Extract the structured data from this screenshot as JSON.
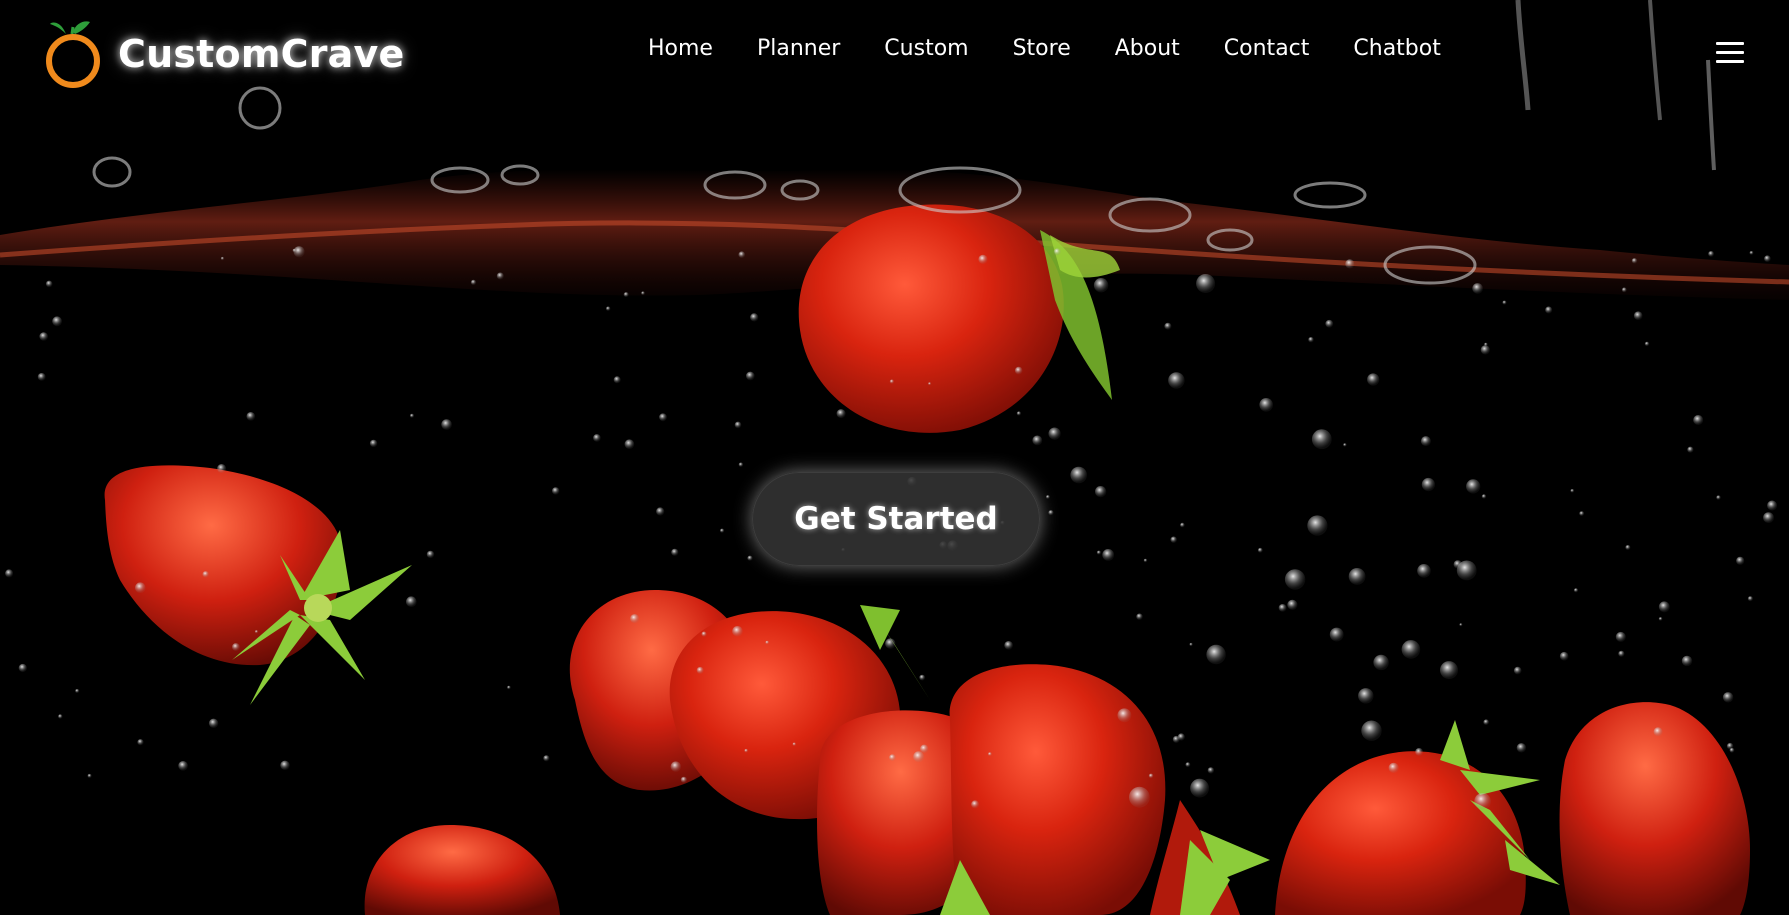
{
  "brand": {
    "name": "CustomCrave",
    "icon": "orange-fruit-icon",
    "colors": {
      "ring": "#f08a1c",
      "leaf": "#2e9e3a"
    }
  },
  "nav": {
    "items": [
      {
        "label": "Home"
      },
      {
        "label": "Planner"
      },
      {
        "label": "Custom"
      },
      {
        "label": "Store"
      },
      {
        "label": "About"
      },
      {
        "label": "Contact"
      },
      {
        "label": "Chatbot"
      }
    ],
    "menu_icon": "hamburger-menu-icon"
  },
  "hero": {
    "cta_label": "Get Started",
    "background": "strawberries-splashing-in-water",
    "colors": {
      "background": "#000000",
      "fruit": "#d42a12",
      "cta_fill": "#343434"
    }
  }
}
